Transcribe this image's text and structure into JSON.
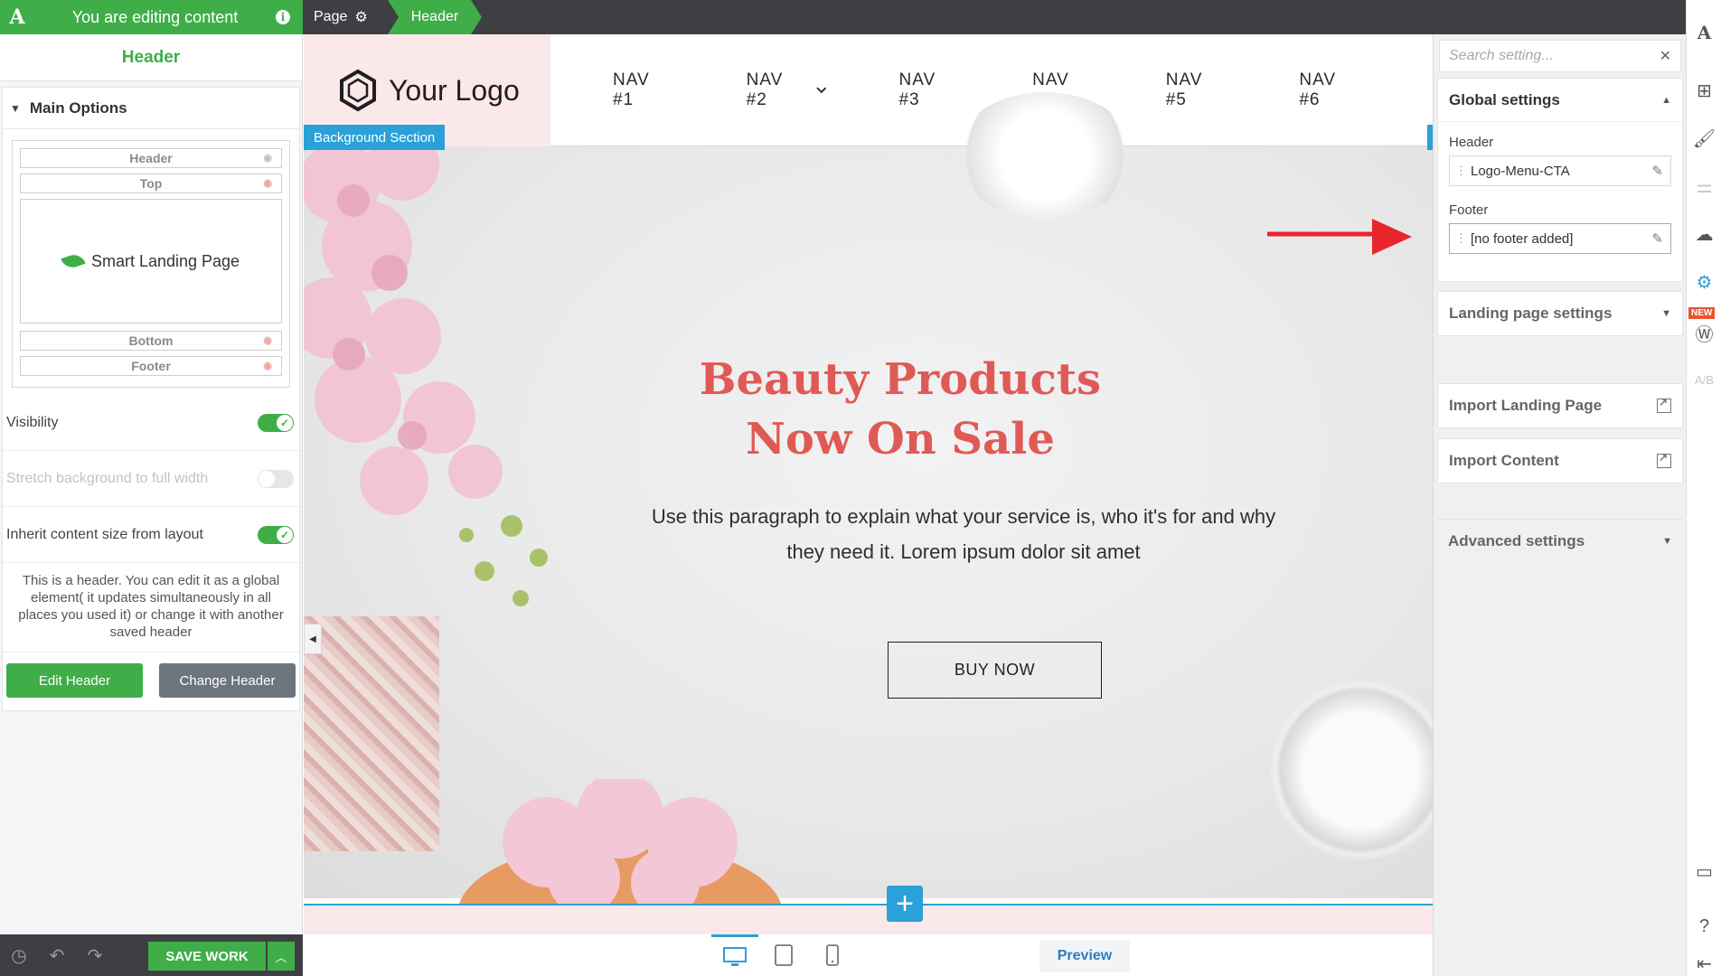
{
  "editor": {
    "banner_text": "You are editing content",
    "brand_letter": "A",
    "breadcrumb": {
      "page": "Page",
      "current": "Header"
    }
  },
  "left_panel": {
    "title": "Header",
    "main_options_label": "Main Options",
    "layout_rows": {
      "header": "Header",
      "top": "Top",
      "bottom": "Bottom",
      "footer": "Footer"
    },
    "content_label": "Smart Landing Page",
    "options": {
      "visibility": "Visibility",
      "stretch": "Stretch background to full width",
      "inherit": "Inherit content size from layout"
    },
    "description": "This is a header. You can edit it as a global element( it updates simultaneously in all places you used it) or change it with another saved header",
    "edit_button": "Edit Header",
    "change_button": "Change Header"
  },
  "bottom_bar": {
    "save_label": "SAVE WORK"
  },
  "site": {
    "logo_text": "Your Logo",
    "nav": [
      "NAV #1",
      "NAV #2",
      "NAV #3",
      "NAV #4",
      "NAV #5",
      "NAV #6"
    ],
    "section_label": "Background Section",
    "hero_title_line1": "Beauty Products",
    "hero_title_line2": "Now On Sale",
    "hero_text": "Use this paragraph to explain what your service is, who it's for and why they need it. Lorem ipsum dolor sit amet",
    "cta": "BUY NOW"
  },
  "device_bar": {
    "preview_label": "Preview"
  },
  "right_panel": {
    "search_placeholder": "Search setting...",
    "global_settings": "Global settings",
    "header_label": "Header",
    "header_value": "Logo-Menu-CTA",
    "footer_label": "Footer",
    "footer_value": "[no footer added]",
    "landing_page_settings": "Landing page settings",
    "import_landing_page": "Import Landing Page",
    "import_content": "Import Content",
    "advanced_settings": "Advanced settings"
  },
  "rail": {
    "new_badge": "NEW",
    "ab_label": "A/B"
  },
  "colors": {
    "brand_green": "#3fae49",
    "accent_blue": "#2aa1d8",
    "hero_title": "#e05a55",
    "toolbar_dark": "#3d3f42",
    "logo_pink": "#fbe8ea"
  }
}
